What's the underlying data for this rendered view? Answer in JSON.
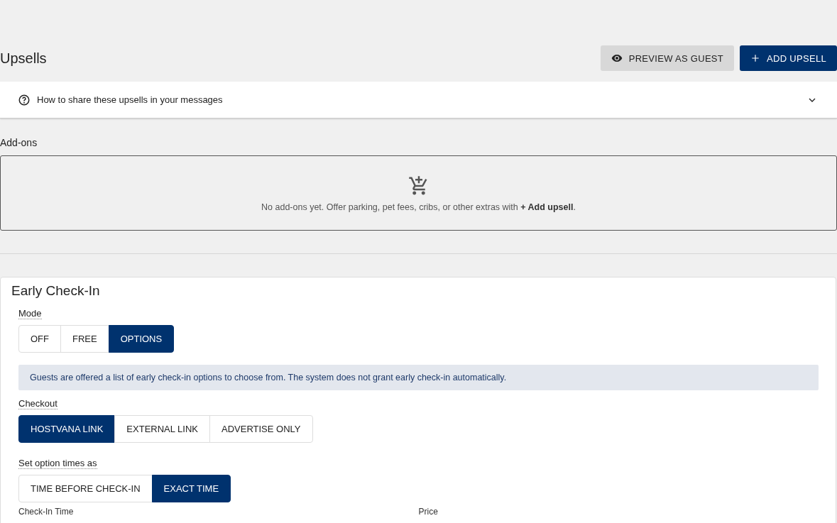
{
  "page": {
    "title": "Upsells"
  },
  "header_buttons": [
    {
      "kind": "secondary",
      "label": "PREVIEW AS GUEST"
    },
    {
      "kind": "primary",
      "label": "ADD UPSELL"
    }
  ],
  "help_accordion": {
    "label": "How to share these upsells in your messages",
    "expanded": false
  },
  "addons": {
    "heading": "Add-ons",
    "empty_text": "No add-ons yet. Offer parking, pet fees, cribs, or other extras with **+ Add upsell**."
  },
  "early_checkin": {
    "title": "Early Check-In",
    "groups": [
      {
        "label": "Mode",
        "options": [
          {
            "label": "OFF",
            "selected": false
          },
          {
            "label": "FREE",
            "selected": false
          },
          {
            "label": "OPTIONS",
            "selected": true
          }
        ],
        "info": "Guests are offered a list of early check-in options to choose from. The system does not grant early check-in automatically."
      },
      {
        "label": "Checkout",
        "options": [
          {
            "label": "HOSTVANA LINK",
            "selected": true
          },
          {
            "label": "EXTERNAL LINK",
            "selected": false
          },
          {
            "label": "ADVERTISE ONLY",
            "selected": false
          }
        ]
      },
      {
        "label": "Set option times as",
        "options": [
          {
            "label": "TIME BEFORE CHECK-IN",
            "selected": false
          },
          {
            "label": "EXACT TIME",
            "selected": true
          }
        ]
      }
    ],
    "columns": [
      "Check-In Time",
      "Price"
    ]
  }
}
